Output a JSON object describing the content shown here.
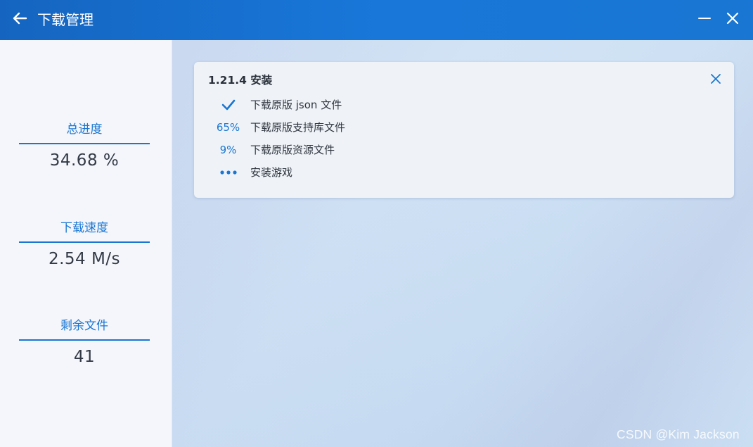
{
  "window": {
    "title": "下载管理",
    "back_icon": "arrow-left-icon",
    "minimize_icon": "minimize-icon",
    "close_icon": "close-icon",
    "accent": "#1976d2"
  },
  "sidebar": {
    "stats": [
      {
        "label": "总进度",
        "value": "34.68 %"
      },
      {
        "label": "下载速度",
        "value": "2.54 M/s"
      },
      {
        "label": "剩余文件",
        "value": "41"
      }
    ]
  },
  "task_card": {
    "title": "1.21.4 安装",
    "close_icon": "close-icon",
    "steps": [
      {
        "status": "done",
        "status_icon": "checkmark-icon",
        "status_text": "",
        "label": "下载原版 json 文件"
      },
      {
        "status": "in-progress",
        "status_icon": "",
        "status_text": "65%",
        "label": "下载原版支持库文件"
      },
      {
        "status": "in-progress",
        "status_icon": "",
        "status_text": "9%",
        "label": "下载原版资源文件"
      },
      {
        "status": "pending",
        "status_icon": "more-dots-icon",
        "status_text": "",
        "label": "安装游戏"
      }
    ]
  },
  "watermark": "CSDN @Kim Jackson"
}
